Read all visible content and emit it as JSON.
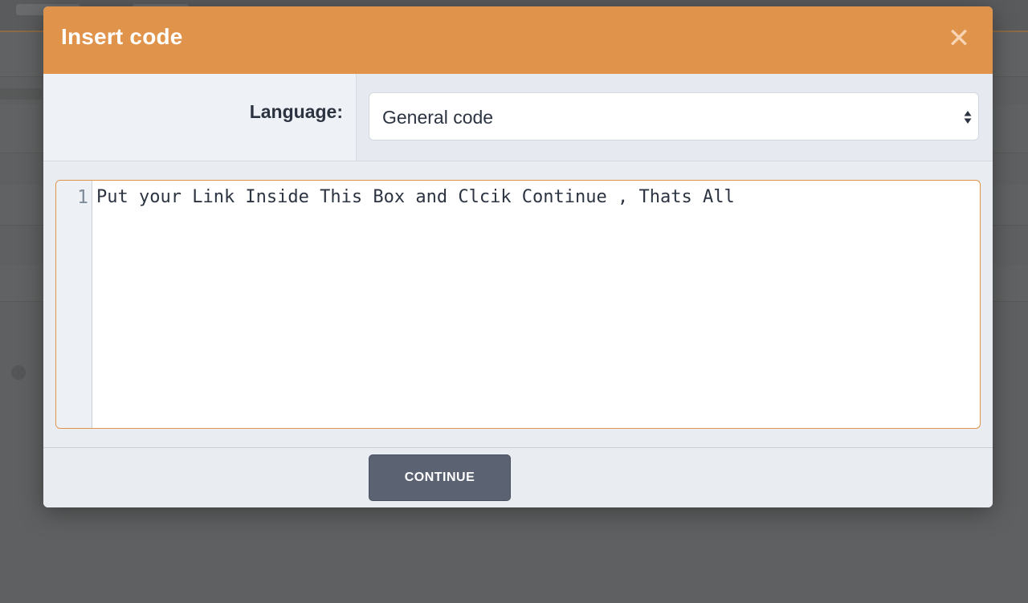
{
  "modal": {
    "title": "Insert code",
    "close_icon": "close-icon",
    "close_glyph": "✕"
  },
  "language": {
    "label": "Language:",
    "selected": "General code",
    "arrows_icon": "select-arrows-icon"
  },
  "editor": {
    "lines": [
      {
        "number": "1",
        "text": "Put your Link Inside This Box and Clcik Continue , Thats All"
      }
    ]
  },
  "footer": {
    "continue_label": "CONTINUE"
  },
  "colors": {
    "header": "#e0934b",
    "modal_bg": "#e9ecf1",
    "button": "#5b6373",
    "backdrop": "#5f6061"
  }
}
